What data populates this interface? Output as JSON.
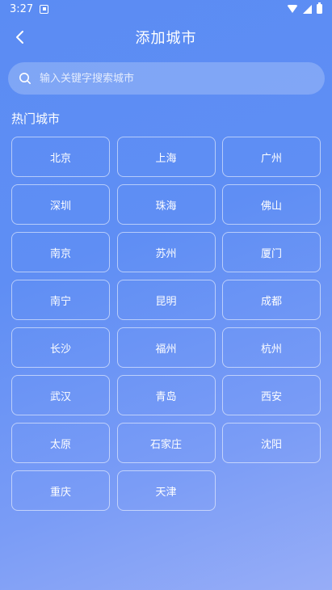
{
  "status_bar": {
    "time": "3:27",
    "icons": [
      "notification-icon",
      "wifi-icon",
      "signal-icon",
      "battery-icon"
    ]
  },
  "header": {
    "title": "添加城市",
    "back_icon": "chevron-left-icon"
  },
  "search": {
    "placeholder": "输入关键字搜索城市",
    "value": "",
    "icon": "search-icon"
  },
  "hot_cities": {
    "title": "热门城市",
    "cities": [
      "北京",
      "上海",
      "广州",
      "深圳",
      "珠海",
      "佛山",
      "南京",
      "苏州",
      "厦门",
      "南宁",
      "昆明",
      "成都",
      "长沙",
      "福州",
      "杭州",
      "武汉",
      "青岛",
      "西安",
      "太原",
      "石家庄",
      "沈阳",
      "重庆",
      "天津"
    ]
  },
  "colors": {
    "background_top": "#5b8cf3",
    "background_bottom": "#97adf7",
    "text": "#ffffff"
  }
}
